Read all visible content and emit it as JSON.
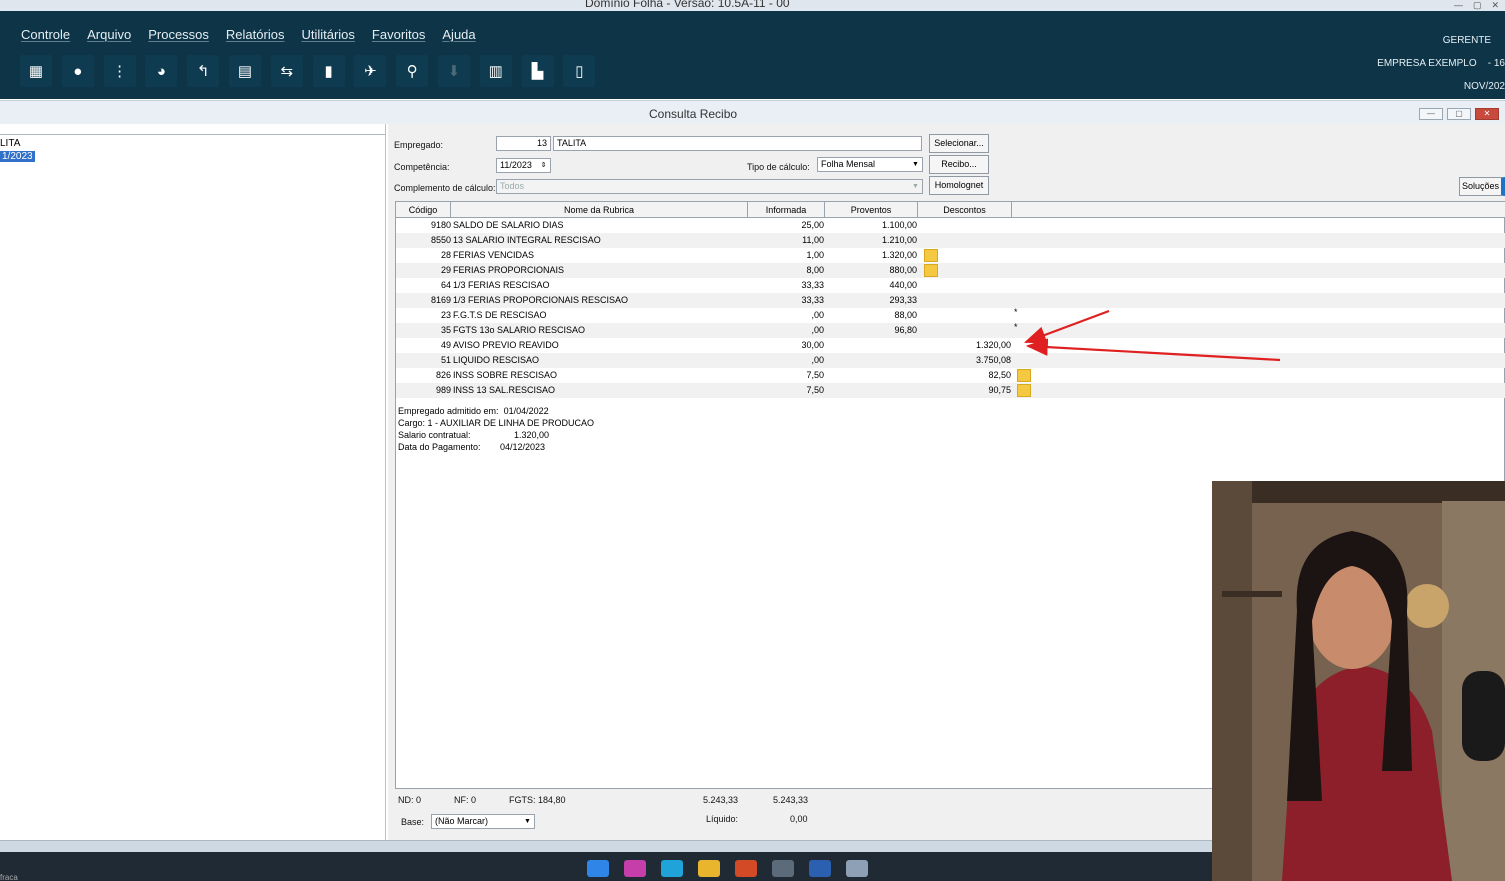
{
  "app_title": "Domínio Folha - Versão: 10.5A-11 - 00",
  "menu": [
    "Controle",
    "Arquivo",
    "Processos",
    "Relatórios",
    "Utilitários",
    "Favoritos",
    "Ajuda"
  ],
  "user": {
    "role": "GERENTE",
    "company": "EMPRESA EXEMPLO",
    "company_code": "- 16",
    "period": "NOV/202"
  },
  "window_title": "Consulta Recibo",
  "left_list": {
    "line1": "LITA",
    "line2_selected": "1/2023"
  },
  "form": {
    "empregado_label": "Empregado:",
    "empregado_code": "13",
    "empregado_name": "TALITA",
    "competencia_label": "Competência:",
    "competencia_value": "11/2023",
    "tipo_calculo_label": "Tipo de cálculo:",
    "tipo_calculo_value": "Folha Mensal",
    "complemento_label": "Complemento de cálculo:",
    "complemento_value": "Todos",
    "btn_selecionar": "Selecionar...",
    "btn_recibo": "Recibo...",
    "btn_homolognet": "Homolognet",
    "btn_solucoes": "Soluções"
  },
  "grid": {
    "columns": [
      "Código",
      "Nome da Rubrica",
      "Informada",
      "Proventos",
      "Descontos"
    ],
    "rows": [
      {
        "code": "9180",
        "name": "SALDO DE SALARIO DIAS",
        "informada": "25,00",
        "proventos": "1.100,00",
        "descontos": ""
      },
      {
        "code": "8550",
        "name": "13 SALARIO INTEGRAL RESCISAO",
        "informada": "11,00",
        "proventos": "1.210,00",
        "descontos": ""
      },
      {
        "code": "28",
        "name": "FERIAS VENCIDAS",
        "informada": "1,00",
        "proventos": "1.320,00",
        "descontos": ""
      },
      {
        "code": "29",
        "name": "FERIAS PROPORCIONAIS",
        "informada": "8,00",
        "proventos": "880,00",
        "descontos": ""
      },
      {
        "code": "64",
        "name": "1/3 FERIAS RESCISAO",
        "informada": "33,33",
        "proventos": "440,00",
        "descontos": ""
      },
      {
        "code": "8169",
        "name": "1/3 FERIAS PROPORCIONAIS RESCISAO",
        "informada": "33,33",
        "proventos": "293,33",
        "descontos": ""
      },
      {
        "code": "23",
        "name": "F.G.T.S DE RESCISAO",
        "informada": ",00",
        "proventos": "88,00",
        "descontos": "*"
      },
      {
        "code": "35",
        "name": "FGTS 13o SALARIO RESCISAO",
        "informada": ",00",
        "proventos": "96,80",
        "descontos": "*"
      },
      {
        "code": "49",
        "name": "AVISO PREVIO REAVIDO",
        "informada": "30,00",
        "proventos": "",
        "descontos": "1.320,00"
      },
      {
        "code": "51",
        "name": "LIQUIDO RESCISAO",
        "informada": ",00",
        "proventos": "",
        "descontos": "3.750,08"
      },
      {
        "code": "826",
        "name": "INSS SOBRE RESCISAO",
        "informada": "7,50",
        "proventos": "",
        "descontos": "82,50"
      },
      {
        "code": "989",
        "name": "INSS 13 SAL.RESCISAO",
        "informada": "7,50",
        "proventos": "",
        "descontos": "90,75"
      }
    ]
  },
  "notes": {
    "admitido_label": "Empregado admitido em:",
    "admitido_value": "01/04/2022",
    "cargo": "Cargo: 1 - AUXILIAR DE LINHA DE PRODUCAO",
    "salario_label": "Salario contratual:",
    "salario_value": "1.320,00",
    "pagamento_label": "Data do Pagamento:",
    "pagamento_value": "04/12/2023"
  },
  "footer": {
    "nd": "ND: 0",
    "nf": "NF: 0",
    "fgts": "FGTS: 184,80",
    "total_proventos": "5.243,33",
    "total_descontos": "5.243,33",
    "base_label": "Base:",
    "base_value": "(Não Marcar)",
    "liquido_label": "Líquido:",
    "liquido_value": "0,00"
  },
  "status_text": "fraca",
  "colors": {
    "app_bar": "#0d3447",
    "selection": "#3271c9",
    "annotation_arrow": "#e02020",
    "icon_yellow": "#f5c842"
  }
}
